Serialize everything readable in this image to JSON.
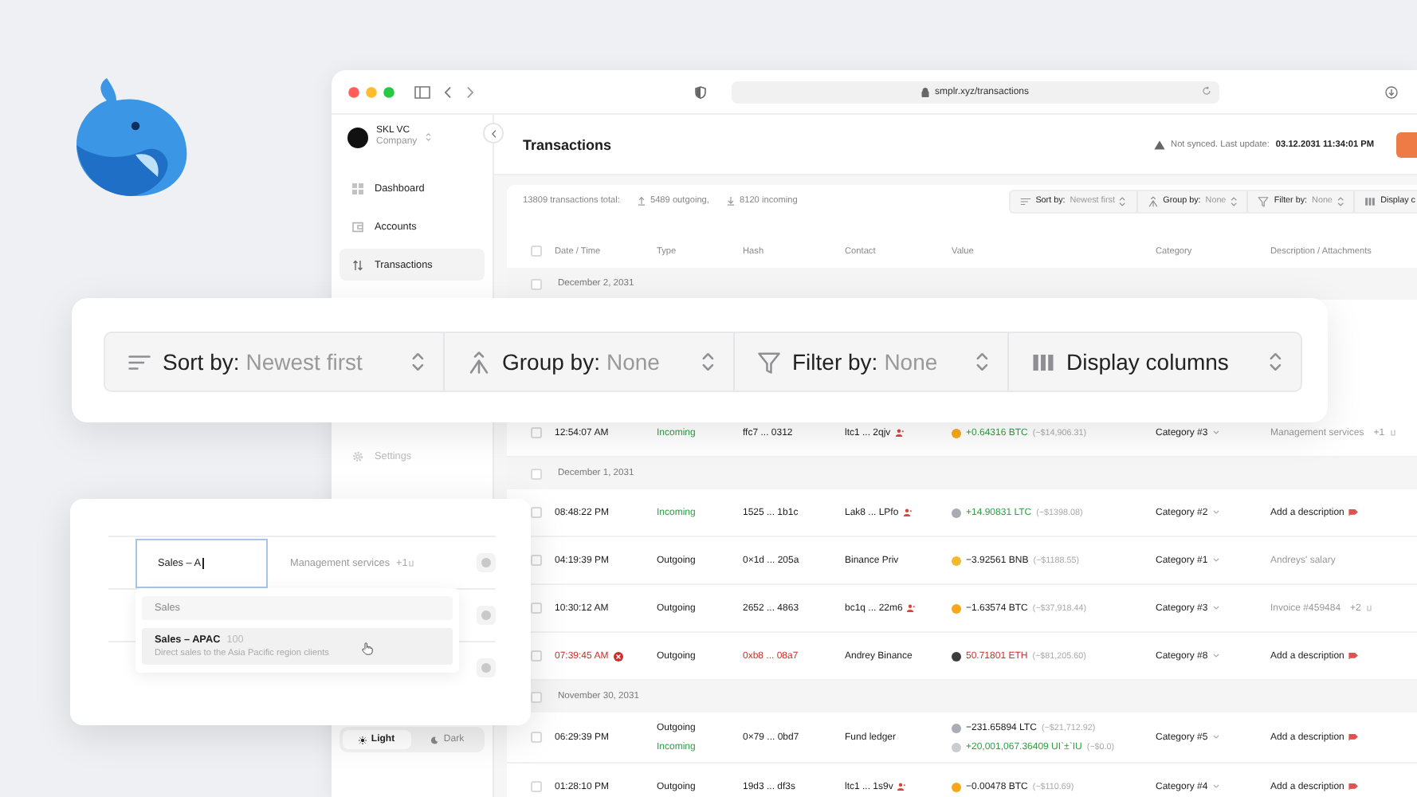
{
  "browser": {
    "url": "smplr.xyz/transactions"
  },
  "sidebar": {
    "workspace": {
      "name": "SKL VC",
      "subtitle": "Company"
    },
    "items": [
      {
        "kind": "dashboard",
        "label": "Dashboard",
        "selected": false
      },
      {
        "kind": "accounts",
        "label": "Accounts",
        "selected": false
      },
      {
        "kind": "transactions",
        "label": "Transactions",
        "selected": true
      }
    ],
    "footer_items": [
      {
        "kind": "settings",
        "label": "Settings"
      }
    ],
    "theme": [
      {
        "kind": "light",
        "label": "Light",
        "selected": true
      },
      {
        "kind": "dark",
        "label": "Dark",
        "selected": false
      }
    ]
  },
  "header": {
    "title": "Transactions",
    "sync_status": "Not synced. Last update:",
    "last_update": "03.12.2031 11:34:01 PM"
  },
  "summary": {
    "total": "13809 transactions total:",
    "outgoing": "5489 outgoing,",
    "incoming": "8120 incoming"
  },
  "toolbar": [
    {
      "kind": "sort",
      "label": "Sort by:",
      "value": "Newest first"
    },
    {
      "kind": "group",
      "label": "Group by:",
      "value": "None"
    },
    {
      "kind": "filter",
      "label": "Filter by:",
      "value": "None"
    },
    {
      "kind": "columns",
      "label": "Display c"
    }
  ],
  "table": {
    "select_all": {
      "checked": false
    },
    "columns": [
      "Date / Time",
      "Type",
      "Hash",
      "Contact",
      "Value",
      "Category",
      "Description / Attachments"
    ],
    "groups": [
      {
        "date": "December 2, 2031",
        "checked": false,
        "rows": [
          {
            "checked": false,
            "time": "12:54:07 AM",
            "failed": false,
            "types": [
              {
                "label": "Incoming",
                "kind": "in"
              }
            ],
            "hash": "ffc7 ... 0312",
            "contact": "ltc1 ... 2qjv",
            "linked": true,
            "values": [
              {
                "amount": "+0.64316 BTC",
                "fiat": "(~$14,906.31)",
                "kind": "in",
                "color": "#f7a81a"
              }
            ],
            "category": "Category #3",
            "description": {
              "kind": "note",
              "text": "Management services"
            },
            "attachments": "+1"
          }
        ]
      },
      {
        "date": "December 1, 2031",
        "checked": false,
        "rows": [
          {
            "checked": false,
            "time": "08:48:22 PM",
            "failed": false,
            "types": [
              {
                "label": "Incoming",
                "kind": "in"
              }
            ],
            "hash": "1525 ... 1b1c",
            "contact": "Lak8 ... LPfo",
            "linked": true,
            "values": [
              {
                "amount": "+14.90831 LTC",
                "fiat": "(~$1398.08)",
                "kind": "in",
                "color": "#a8acb3"
              }
            ],
            "category": "Category #2",
            "description": {
              "kind": "action",
              "text": "Add a description"
            }
          },
          {
            "checked": false,
            "time": "04:19:39 PM",
            "failed": false,
            "types": [
              {
                "label": "Outgoing",
                "kind": "out"
              }
            ],
            "hash": "0×1d ... 205a",
            "contact": "Binance Priv",
            "linked": false,
            "values": [
              {
                "amount": "−3.92561 BNB",
                "fiat": "(~$1188.55)",
                "kind": "out",
                "color": "#f3ba2f"
              }
            ],
            "category": "Category #1",
            "description": {
              "kind": "note",
              "text": "Andreys' salary"
            }
          },
          {
            "checked": false,
            "time": "10:30:12 AM",
            "failed": false,
            "types": [
              {
                "label": "Outgoing",
                "kind": "out"
              }
            ],
            "hash": "2652 ... 4863",
            "contact": "bc1q ... 22m6",
            "linked": true,
            "values": [
              {
                "amount": "−1.63574 BTC",
                "fiat": "(~$37,918.44)",
                "kind": "out",
                "color": "#f7a81a"
              }
            ],
            "category": "Category #3",
            "description": {
              "kind": "note",
              "text": "Invoice #459484"
            },
            "attachments": "+2"
          },
          {
            "checked": false,
            "time": "07:39:45 AM",
            "failed": true,
            "types": [
              {
                "label": "Outgoing",
                "kind": "out"
              }
            ],
            "hash": "0xb8 ... 08a7",
            "contact": "Andrey Binance",
            "linked": false,
            "values": [
              {
                "amount": "50.71801 ETH",
                "fiat": "(~$81,205.60)",
                "kind": "out",
                "color": "#3c3c3d"
              }
            ],
            "category": "Category #8",
            "description": {
              "kind": "action",
              "text": "Add a description"
            }
          }
        ]
      },
      {
        "date": "November 30, 2031",
        "checked": false,
        "rows": [
          {
            "checked": false,
            "time": "06:29:39 PM",
            "failed": false,
            "types": [
              {
                "label": "Outgoing",
                "kind": "out"
              },
              {
                "label": "Incoming",
                "kind": "in"
              }
            ],
            "hash": "0×79 ... 0bd7",
            "contact": "Fund ledger",
            "linked": false,
            "values": [
              {
                "amount": "−231.65894 LTC",
                "fiat": "(~$21,712.92)",
                "kind": "out",
                "color": "#a8acb3"
              },
              {
                "amount": "+20,001,067.36409 UI`±`IU",
                "fiat": "(~$0.0)",
                "kind": "in",
                "color": "#c9ccd1"
              }
            ],
            "category": "Category #5",
            "description": {
              "kind": "action",
              "text": "Add a description"
            }
          },
          {
            "checked": false,
            "time": "01:28:10 PM",
            "failed": false,
            "types": [
              {
                "label": "Outgoing",
                "kind": "out"
              }
            ],
            "hash": "19d3 ... df3s",
            "contact": "ltc1 ... 1s9v",
            "linked": true,
            "values": [
              {
                "amount": "−0.00478 BTC",
                "fiat": "(~$110.69)",
                "kind": "out",
                "color": "#f7a81a"
              }
            ],
            "category": "Category #4",
            "description": {
              "kind": "action",
              "text": "Add a description"
            }
          }
        ]
      }
    ]
  },
  "toolbar_card": {
    "items": [
      {
        "kind": "sort",
        "label": "Sort by:",
        "value": "Newest first"
      },
      {
        "kind": "group",
        "label": "Group by:",
        "value": "None"
      },
      {
        "kind": "filter",
        "label": "Filter by:",
        "value": "None"
      },
      {
        "kind": "columns",
        "label": "Display columns"
      }
    ]
  },
  "edit_card": {
    "field_value": "Sales – A",
    "description": "Management services",
    "attachments": "+1",
    "options": [
      {
        "label": "Sales",
        "selected": false
      },
      {
        "label": "Sales – APAC",
        "count": "100",
        "note": "Direct sales to the Asia Pacific region clients",
        "selected": true
      }
    ]
  }
}
